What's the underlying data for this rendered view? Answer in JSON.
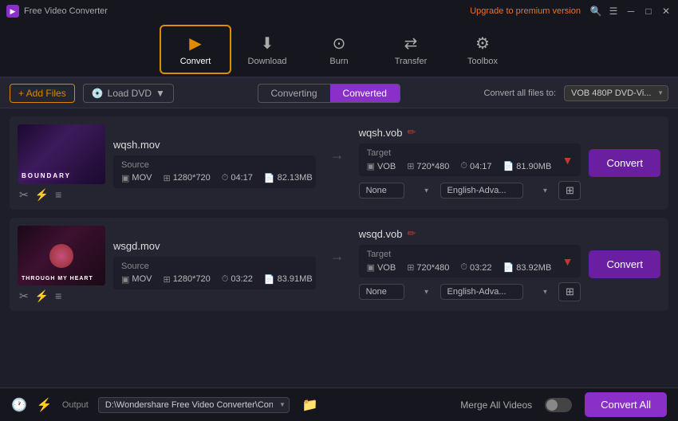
{
  "app": {
    "title": "Free Video Converter",
    "upgrade_label": "Upgrade to premium version"
  },
  "toolbar": {
    "buttons": [
      {
        "id": "convert",
        "label": "Convert",
        "icon": "▶",
        "active": true
      },
      {
        "id": "download",
        "label": "Download",
        "icon": "⬇",
        "active": false
      },
      {
        "id": "burn",
        "label": "Burn",
        "icon": "⊙",
        "active": false
      },
      {
        "id": "transfer",
        "label": "Transfer",
        "icon": "⇄",
        "active": false
      },
      {
        "id": "toolbox",
        "label": "Toolbox",
        "icon": "⚙",
        "active": false
      }
    ]
  },
  "actionbar": {
    "add_files_label": "+ Add Files",
    "load_dvd_label": "Load DVD",
    "tab_converting": "Converting",
    "tab_converted": "Converted",
    "convert_all_files_label": "Convert all files to:",
    "format_value": "VOB 480P DVD-Vi..."
  },
  "videos": [
    {
      "id": "video1",
      "thumb_type": "boundary",
      "source_name": "wqsh.mov",
      "target_name": "wqsh.vob",
      "source": {
        "label": "Source",
        "format": "MOV",
        "resolution": "1280*720",
        "duration": "04:17",
        "size": "82.13MB"
      },
      "target": {
        "label": "Target",
        "format": "VOB",
        "resolution": "720*480",
        "duration": "04:17",
        "size": "81.90MB"
      },
      "subtitle_none": "None",
      "subtitle_lang": "English-Adva...",
      "convert_label": "Convert"
    },
    {
      "id": "video2",
      "thumb_type": "rose",
      "source_name": "wsgd.mov",
      "target_name": "wsqd.vob",
      "source": {
        "label": "Source",
        "format": "MOV",
        "resolution": "1280*720",
        "duration": "03:22",
        "size": "83.91MB"
      },
      "target": {
        "label": "Target",
        "format": "VOB",
        "resolution": "720*480",
        "duration": "03:22",
        "size": "83.92MB"
      },
      "subtitle_none": "None",
      "subtitle_lang": "English-Adva...",
      "convert_label": "Convert"
    }
  ],
  "bottombar": {
    "output_label": "Output",
    "output_path": "D:\\Wondershare Free Video Converter\\Converted",
    "merge_label": "Merge All Videos",
    "convert_all_label": "Convert All"
  }
}
